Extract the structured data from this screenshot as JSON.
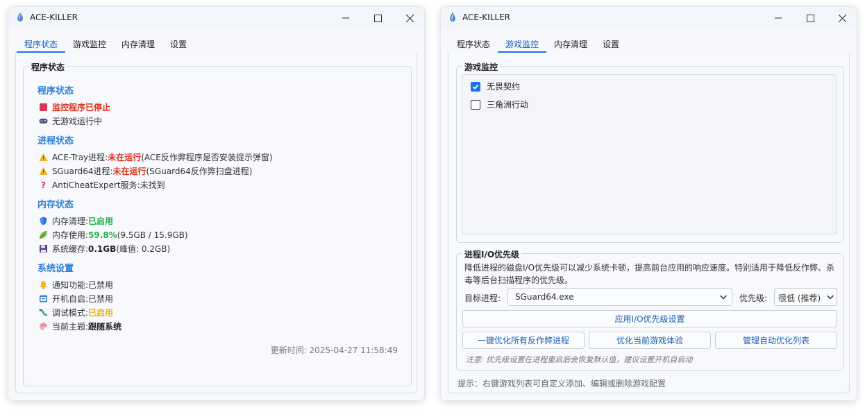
{
  "left_window": {
    "title": "ACE-KILLER",
    "tabs": [
      {
        "label": "程序状态",
        "active": true
      },
      {
        "label": "游戏监控",
        "active": false
      },
      {
        "label": "内存清理",
        "active": false
      },
      {
        "label": "设置",
        "active": false
      }
    ],
    "group_title": "程序状态",
    "program_status": {
      "title": "程序状态",
      "monitor_stopped": "监控程序已停止",
      "no_game": "无游戏运行中"
    },
    "process_status": {
      "title": "进程状态",
      "ace_tray_label": "ACE-Tray进程: ",
      "ace_tray_state": "未在运行",
      "ace_tray_desc": " (ACE反作弊程序是否安装提示弹窗)",
      "sguard_label": "SGuard64进程: ",
      "sguard_state": "未在运行",
      "sguard_desc": " (SGuard64反作弊扫盘进程)",
      "anticheat_label": "AntiCheatExpert服务: ",
      "anticheat_state": "未找到"
    },
    "memory_status": {
      "title": "内存状态",
      "clean_label": "内存清理: ",
      "clean_state": "已启用",
      "usage_label": "内存使用: ",
      "usage_percent": "59.8%",
      "usage_detail": " (9.5GB / 15.9GB)",
      "cache_label": "系统缓存: ",
      "cache_value": "0.1GB",
      "cache_peak": " (峰值: 0.2GB)"
    },
    "system_settings": {
      "title": "系统设置",
      "notify_label": "通知功能: ",
      "notify_state": "已禁用",
      "autostart_label": "开机自启: ",
      "autostart_state": "已禁用",
      "debug_label": "调试模式: ",
      "debug_state": "已启用",
      "theme_label": "当前主题: ",
      "theme_state": "跟随系统"
    },
    "updated": "更新时间: 2025-04-27 11:58:49"
  },
  "right_window": {
    "title": "ACE-KILLER",
    "tabs": [
      {
        "label": "程序状态",
        "active": false
      },
      {
        "label": "游戏监控",
        "active": true
      },
      {
        "label": "内存清理",
        "active": false
      },
      {
        "label": "设置",
        "active": false
      }
    ],
    "game_group_title": "游戏监控",
    "games": [
      {
        "label": "无畏契约",
        "checked": true
      },
      {
        "label": "三角洲行动",
        "checked": false
      }
    ],
    "io_group_title": "进程I/O优先级",
    "io_desc": "降低进程的磁盘I/O优先级可以减少系统卡顿，提高前台应用的响应速度。特别适用于降低反作弊、杀毒等后台扫描程序的优先级。",
    "target_label": "目标进程:",
    "target_value": "SGuard64.exe",
    "priority_label": "优先级:",
    "priority_value": "很低 (推荐)",
    "apply_button": "应用I/O优先级设置",
    "optimize_all_button": "一键优化所有反作弊进程",
    "optimize_game_button": "优化当前游戏体验",
    "manage_list_button": "管理自动优化列表",
    "note": "注意: 优先级设置在进程重启后会恢复默认值，建议设置开机自启动",
    "hint": "提示：右键游戏列表可自定义添加、编辑或删除游戏配置"
  },
  "colors": {
    "accent": "#1a73e8",
    "section_title": "#2a7fd4",
    "danger": "#e0301e",
    "success": "#22b14c",
    "warning": "#e8b20c"
  }
}
